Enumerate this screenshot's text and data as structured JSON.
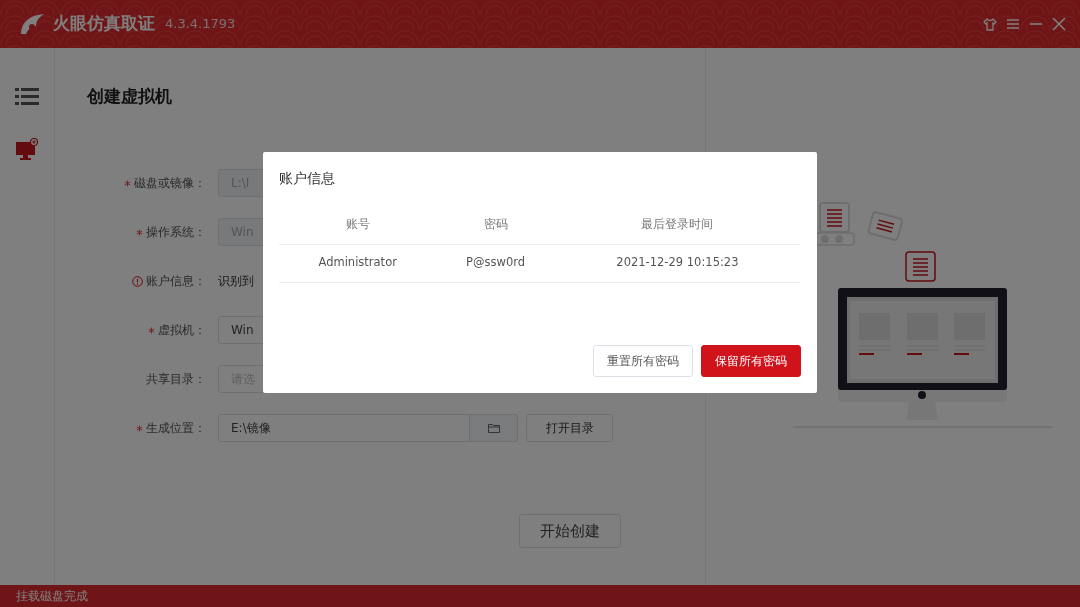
{
  "window": {
    "title": "火眼仿真取证",
    "version": "4.3.4.1793"
  },
  "sidebar": {
    "items": [
      {
        "kind": "create-vm",
        "selected": true
      }
    ]
  },
  "page": {
    "title": "创建虚拟机"
  },
  "form": {
    "fields": [
      {
        "kind": "input",
        "label": "磁盘或镜像：",
        "required": true,
        "disabled": true,
        "value": "L:\\I"
      },
      {
        "kind": "input",
        "label": "操作系统：",
        "required": true,
        "disabled": true,
        "value": "Win"
      },
      {
        "kind": "info",
        "label": "账户信息：",
        "required": false,
        "value": "识别到"
      },
      {
        "kind": "input",
        "label": "虚拟机：",
        "required": true,
        "disabled": false,
        "value": "Win"
      },
      {
        "kind": "input",
        "label": "共享目录：",
        "required": false,
        "disabled": false,
        "placeholder": "请选"
      },
      {
        "kind": "path",
        "label": "生成位置：",
        "required": true,
        "disabled": false,
        "value": "E:\\镜像",
        "button": "打开目录"
      }
    ],
    "submit": "开始创建"
  },
  "modal": {
    "title": "账户信息",
    "columns": [
      "账号",
      "密码",
      "最后登录时间"
    ],
    "rows": [
      [
        "Administrator",
        "P@ssw0rd",
        "2021-12-29 10:15:23"
      ]
    ],
    "buttons": [
      {
        "label": "重置所有密码",
        "kind": "default"
      },
      {
        "label": "保留所有密码",
        "kind": "primary"
      }
    ]
  },
  "status_bar": "挂载磁盘完成"
}
